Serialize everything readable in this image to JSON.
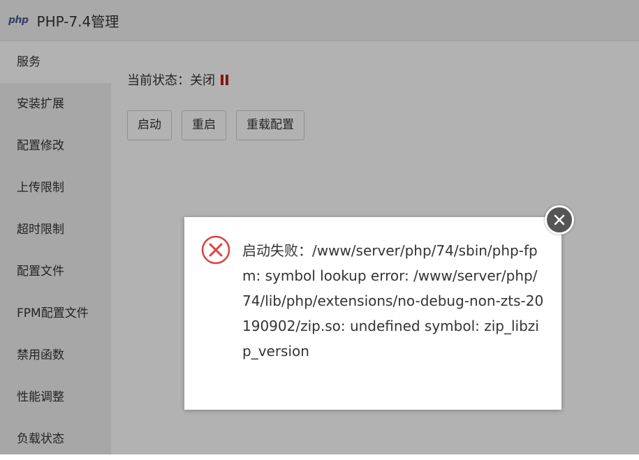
{
  "window": {
    "logo": "php",
    "title": "PHP-7.4管理"
  },
  "sidebar": {
    "items": [
      {
        "label": "服务",
        "active": true
      },
      {
        "label": "安装扩展"
      },
      {
        "label": "配置修改"
      },
      {
        "label": "上传限制"
      },
      {
        "label": "超时限制"
      },
      {
        "label": "配置文件"
      },
      {
        "label": "FPM配置文件"
      },
      {
        "label": "禁用函数"
      },
      {
        "label": "性能调整"
      },
      {
        "label": "负载状态"
      }
    ]
  },
  "main": {
    "status_label": "当前状态：关闭",
    "buttons": {
      "start": "启动",
      "restart": "重启",
      "reload": "重载配置"
    }
  },
  "dialog": {
    "message": "启动失败：/www/server/php/74/sbin/php-fpm: symbol lookup error: /www/server/php/74/lib/php/extensions/no-debug-non-zts-20190902/zip.so: undefined symbol: zip_libzip_version",
    "icon": "error-circle-icon"
  },
  "colors": {
    "error_red": "#e0413d",
    "status_stop_red": "#c81a1a",
    "php_logo": "#4f5b93"
  }
}
